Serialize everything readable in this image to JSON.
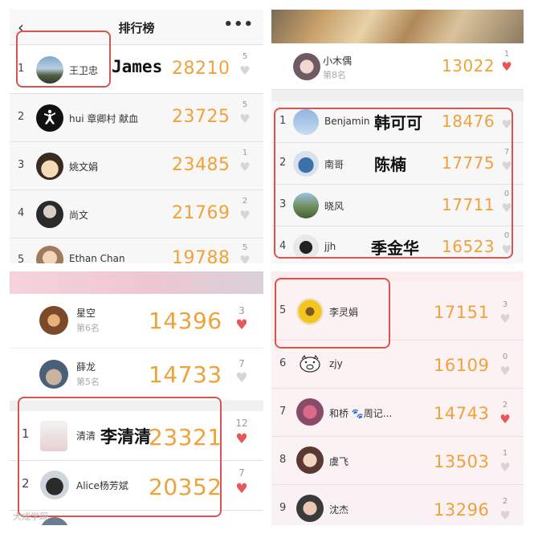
{
  "colors": {
    "steps": "#f0a23a",
    "heart_red": "#e8565a",
    "heart_gray": "#d6d6d6",
    "highlight_box": "#d9534f"
  },
  "top_left": {
    "nav": {
      "back_icon": "chevron-left-icon",
      "title": "排行榜",
      "more": "•••"
    },
    "rows": [
      {
        "rank": "1",
        "name": "王卫忠",
        "steps": "28210",
        "likes": "5",
        "liked": false,
        "annotation": "James"
      },
      {
        "rank": "2",
        "name": "hui 章卿村 献血",
        "steps": "23725",
        "likes": "5",
        "liked": false
      },
      {
        "rank": "3",
        "name": "姚文娟",
        "steps": "23485",
        "likes": "1",
        "liked": false
      },
      {
        "rank": "4",
        "name": "尚文",
        "steps": "21769",
        "likes": "2",
        "liked": false
      },
      {
        "rank": "5",
        "name": "Ethan Chan",
        "steps": "19788",
        "likes": "5",
        "liked": false
      }
    ]
  },
  "top_right": {
    "header": {
      "name": "小木偶",
      "sub": "第8名",
      "steps": "13022",
      "likes": "1",
      "liked": true
    },
    "rows": [
      {
        "rank": "1",
        "name": "Benjamin",
        "steps": "18476",
        "likes": "",
        "liked": false,
        "annotation": "韩可可"
      },
      {
        "rank": "2",
        "name": "南哥",
        "steps": "17775",
        "likes": "7",
        "liked": false,
        "annotation": "陈楠"
      },
      {
        "rank": "3",
        "name": "晓风",
        "steps": "17711",
        "likes": "0",
        "liked": false
      },
      {
        "rank": "4",
        "name": "jjh",
        "steps": "16523",
        "likes": "0",
        "liked": false,
        "annotation": "季金华"
      }
    ]
  },
  "bottom_left": {
    "header_rows": [
      {
        "name": "星空",
        "sub": "第6名",
        "steps": "14396",
        "likes": "3",
        "liked": true
      },
      {
        "name": "薛龙",
        "sub": "第5名",
        "steps": "14733",
        "likes": "7",
        "liked": false
      }
    ],
    "rows": [
      {
        "rank": "1",
        "name": "清清",
        "steps": "23321",
        "likes": "12",
        "liked": true,
        "annotation": "李清清"
      },
      {
        "rank": "2",
        "name": "Alice杨芳斌",
        "steps": "20352",
        "likes": "7",
        "liked": true
      }
    ],
    "watermark": "大成学琛"
  },
  "bottom_right": {
    "rows": [
      {
        "rank": "5",
        "name": "李灵娟",
        "steps": "17151",
        "likes": "3",
        "liked": false
      },
      {
        "rank": "6",
        "name": "zjy",
        "steps": "16109",
        "likes": "0",
        "liked": false
      },
      {
        "rank": "7",
        "name": "和桥 🐾周记...",
        "steps": "14743",
        "likes": "2",
        "liked": true
      },
      {
        "rank": "8",
        "name": "虞飞",
        "steps": "13503",
        "likes": "1",
        "liked": false
      },
      {
        "rank": "9",
        "name": "沈杰",
        "steps": "13296",
        "likes": "2",
        "liked": false
      }
    ]
  }
}
